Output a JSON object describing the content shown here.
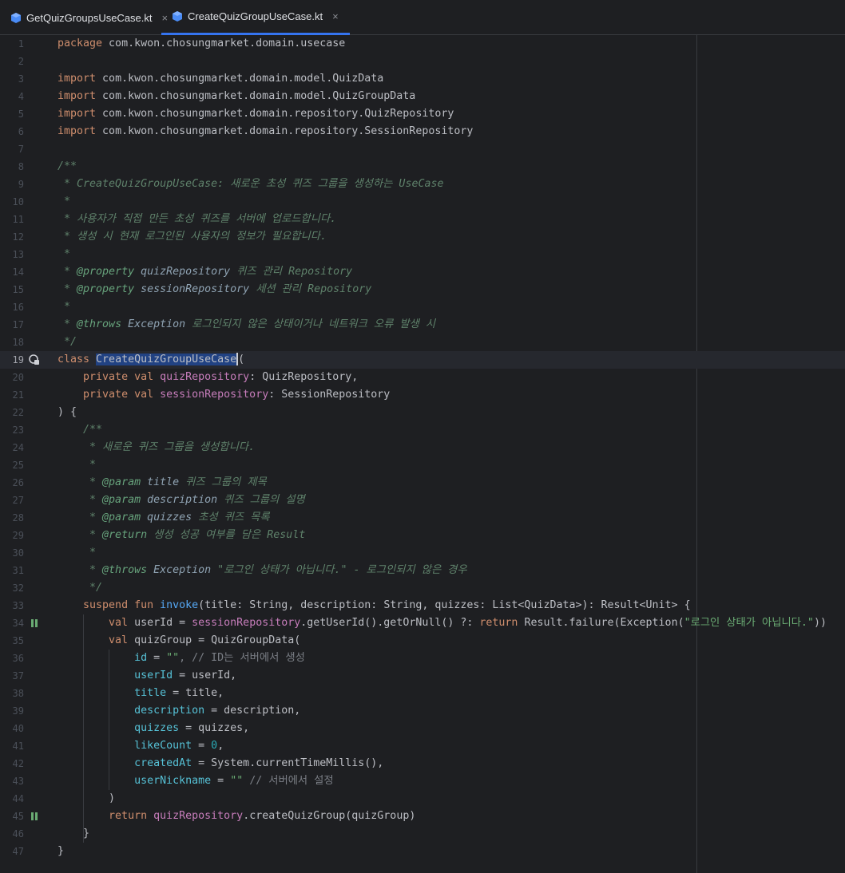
{
  "tabs": [
    {
      "label": "GetQuizGroupsUseCase.kt",
      "active": false
    },
    {
      "label": "CreateQuizGroupUseCase.kt",
      "active": true
    }
  ],
  "tab_close_glyph": "×",
  "colors": {
    "accent": "#3574f0",
    "background": "#1e1f22",
    "keyword": "#cf8e6d",
    "function": "#56a8f5",
    "string": "#6aab73",
    "comment": "#5f826b"
  },
  "line_numbers": [
    "1",
    "2",
    "3",
    "4",
    "5",
    "6",
    "7",
    "8",
    "9",
    "10",
    "11",
    "12",
    "13",
    "14",
    "15",
    "16",
    "17",
    "18",
    "19",
    "20",
    "21",
    "22",
    "23",
    "24",
    "25",
    "26",
    "27",
    "28",
    "29",
    "30",
    "31",
    "32",
    "33",
    "34",
    "35",
    "36",
    "37",
    "38",
    "39",
    "40",
    "41",
    "42",
    "43",
    "44",
    "45",
    "46",
    "47"
  ],
  "current_line": "19",
  "code": {
    "l1_kw": "package",
    "l1_rest": " com.kwon.chosungmarket.domain.usecase",
    "imp_kw": "import",
    "l3": " com.kwon.chosungmarket.domain.model.QuizData",
    "l4": " com.kwon.chosungmarket.domain.model.QuizGroupData",
    "l5": " com.kwon.chosungmarket.domain.repository.QuizRepository",
    "l6": " com.kwon.chosungmarket.domain.repository.SessionRepository",
    "l8": "/**",
    "l9": " * CreateQuizGroupUseCase: 새로운 초성 퀴즈 그룹을 생성하는 UseCase",
    "star": " *",
    "l11": " * 사용자가 직접 만든 초성 퀴즈를 서버에 업로드합니다.",
    "l12": " * 생성 시 현재 로그인된 사용자의 정보가 필요합니다.",
    "l14_a": " * ",
    "l14_tag": "@property",
    "l14_arg": " quizRepository",
    "l14_rest": " 퀴즈 관리 Repository",
    "l15_a": " * ",
    "l15_tag": "@property",
    "l15_arg": " sessionRepository",
    "l15_rest": " 세션 관리 Repository",
    "l17_a": " * ",
    "l17_tag": "@throws",
    "l17_arg": " Exception",
    "l17_rest": " 로그인되지 않은 상태이거나 네트워크 오류 발생 시",
    "l18": " */",
    "l19_kw": "class",
    "l19_name": "CreateQuizGroupUseCase",
    "l19_paren": "(",
    "private_val": "private val",
    "l20_prop": "quizRepository",
    "l20_rest": ": QuizRepository,",
    "l21_prop": "sessionRepository",
    "l21_rest": ": SessionRepository",
    "l22": ") {",
    "l23": "/**",
    "l24": " * 새로운 퀴즈 그룹을 생성합니다.",
    "l26_tag": "@param",
    "l26_arg": " title",
    "l26_rest": " 퀴즈 그룹의 제목",
    "l27_tag": "@param",
    "l27_arg": " description",
    "l27_rest": " 퀴즈 그룹의 설명",
    "l28_tag": "@param",
    "l28_arg": " quizzes",
    "l28_rest": " 초성 퀴즈 목록",
    "l29_tag": "@return",
    "l29_rest": " 생성 성공 여부를 담은 Result",
    "l31_tag": "@throws",
    "l31_arg": " Exception",
    "l31_rest": " \"로그인 상태가 아닙니다.\" - 로그인되지 않은 경우",
    "l32": " */",
    "l33_kw": "suspend fun",
    "l33_fn": "invoke",
    "l33_rest": "(title: String, description: String, quizzes: List<QuizData>): Result<Unit> {",
    "val": "val",
    "l34_a": " userId = ",
    "l34_prop": "sessionRepository",
    "l34_b": ".getUserId().getOrNull() ?: ",
    "l34_ret": "return",
    "l34_c": " Result.failure(Exception(",
    "l34_str": "\"로그인 상태가 아닙니다.\"",
    "l34_d": "))",
    "l35_a": " quizGroup = QuizGroupData(",
    "l36_named": "id",
    "l36_eq": " = ",
    "l36_str": "\"\"",
    "l36_cmt": ", // ID는 서버에서 생성",
    "l37_named": "userId",
    "l37_rest": " = userId,",
    "l38_named": "title",
    "l38_rest": " = title,",
    "l39_named": "description",
    "l39_rest": " = description,",
    "l40_named": "quizzes",
    "l40_rest": " = quizzes,",
    "l41_named": "likeCount",
    "l41_eq": " = ",
    "l41_num": "0",
    "l41_comma": ",",
    "l42_named": "createdAt",
    "l42_rest": " = System.currentTimeMillis(),",
    "l43_named": "userNickname",
    "l43_eq": " = ",
    "l43_str": "\"\"",
    "l43_cmt": " // 서버에서 설정",
    "l44": ")",
    "l45_kw": "return",
    "l45_prop": " quizRepository",
    "l45_rest": ".createQuizGroup(quizGroup)",
    "l46": "}",
    "l47": "}"
  }
}
